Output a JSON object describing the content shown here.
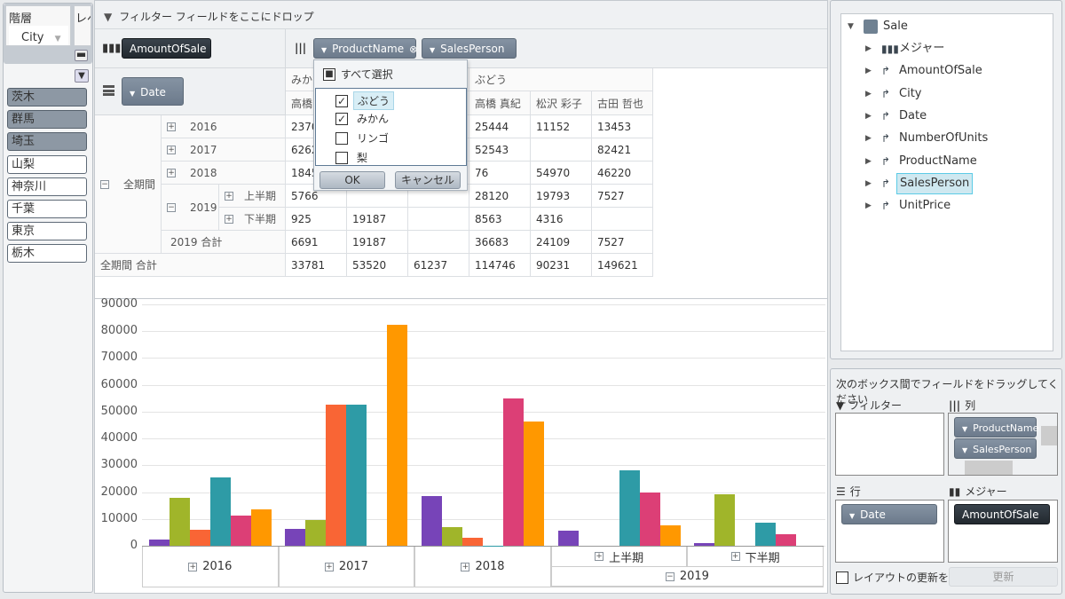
{
  "left_panel": {
    "hierarchy_label": "階層",
    "level_label": "レベル",
    "hierarchy_value": "City",
    "slicer_items": [
      {
        "label": "茨木",
        "selected": true
      },
      {
        "label": "群馬",
        "selected": true
      },
      {
        "label": "埼玉",
        "selected": true
      },
      {
        "label": "山梨",
        "selected": false
      },
      {
        "label": "神奈川",
        "selected": false
      },
      {
        "label": "千葉",
        "selected": false
      },
      {
        "label": "東京",
        "selected": false
      },
      {
        "label": "栃木",
        "selected": false
      }
    ]
  },
  "pivot": {
    "filter_drop_text": "フィルター フィールドをここにドロップ",
    "measure_chip": "AmountOfSale",
    "column_chips": [
      "ProductName",
      "SalesPerson"
    ],
    "row_chip": "Date",
    "col_headers_level1": [
      "みかん",
      "",
      "",
      "ぶどう",
      "",
      ""
    ],
    "col_headers_level2": [
      "高橋",
      "",
      "",
      "高橋 真紀",
      "松沢 彩子",
      "古田 哲也"
    ],
    "row_labels": {
      "all_period": "全期間",
      "years": [
        "2016",
        "2017",
        "2018",
        "2019"
      ],
      "halves": [
        "上半期",
        "下半期"
      ],
      "year_total": "2019  合計",
      "grand_total": "全期間  合計"
    },
    "rows": [
      [
        "2370",
        "",
        "",
        "25444",
        "11152",
        "13453"
      ],
      [
        "6262",
        "",
        "",
        "52543",
        "",
        "82421"
      ],
      [
        "1845",
        "",
        "",
        "76",
        "54970",
        "46220"
      ],
      [
        "5766",
        "",
        "",
        "28120",
        "19793",
        "7527"
      ],
      [
        "925",
        "19187",
        "",
        "8563",
        "4316",
        ""
      ],
      [
        "6691",
        "19187",
        "",
        "36683",
        "24109",
        "7527"
      ],
      [
        "33781",
        "53520",
        "61237",
        "114746",
        "90231",
        "149621"
      ]
    ]
  },
  "filter_popup": {
    "select_all": "すべて選択",
    "items": [
      {
        "label": "ぶどう",
        "checked": true
      },
      {
        "label": "みかん",
        "checked": true
      },
      {
        "label": "リンゴ",
        "checked": false
      },
      {
        "label": "梨",
        "checked": false
      }
    ],
    "ok": "OK",
    "cancel": "キャンセル"
  },
  "chart_data": {
    "type": "bar",
    "categories": [
      "2016",
      "2017",
      "2018",
      "上半期",
      "下半期"
    ],
    "category_group": {
      "label": "2019",
      "members": [
        "上半期",
        "下半期"
      ]
    },
    "ylim": [
      0,
      90000
    ],
    "yticks": [
      "0",
      "10000",
      "20000",
      "30000",
      "40000",
      "50000",
      "60000",
      "70000",
      "80000",
      "90000"
    ],
    "grid": true,
    "series": [
      {
        "color": "#7744b8",
        "values": [
          2370,
          6262,
          18458,
          5766,
          925
        ]
      },
      {
        "color": "#a0b52a",
        "values": [
          17800,
          9520,
          7013,
          null,
          19187
        ]
      },
      {
        "color": "#f96535",
        "values": [
          5800,
          52500,
          2937,
          null,
          null
        ]
      },
      {
        "color": "#2e9ba6",
        "values": [
          25444,
          52543,
          76,
          28120,
          8563
        ]
      },
      {
        "color": "#dc3f76",
        "values": [
          11152,
          null,
          54970,
          19793,
          4316
        ]
      },
      {
        "color": "#ff9800",
        "values": [
          13453,
          82421,
          46220,
          7527,
          null
        ]
      }
    ]
  },
  "field_tree": {
    "root": "Sale",
    "items": [
      "メジャー",
      "AmountOfSale",
      "City",
      "Date",
      "NumberOfUnits",
      "ProductName",
      "SalesPerson",
      "UnitPrice"
    ],
    "selected": "SalesPerson"
  },
  "layout_panel": {
    "instruction": "次のボックス間でフィールドをドラッグしてください",
    "filter_label": "フィルター",
    "columns_label": "列",
    "rows_label": "行",
    "measures_label": "メジャー",
    "column_fields": [
      "ProductName",
      "SalesPerson"
    ],
    "row_fields": [
      "Date"
    ],
    "measure_fields": [
      "AmountOfSale"
    ],
    "defer_label": "レイアウトの更新を保",
    "update_button": "更新"
  }
}
